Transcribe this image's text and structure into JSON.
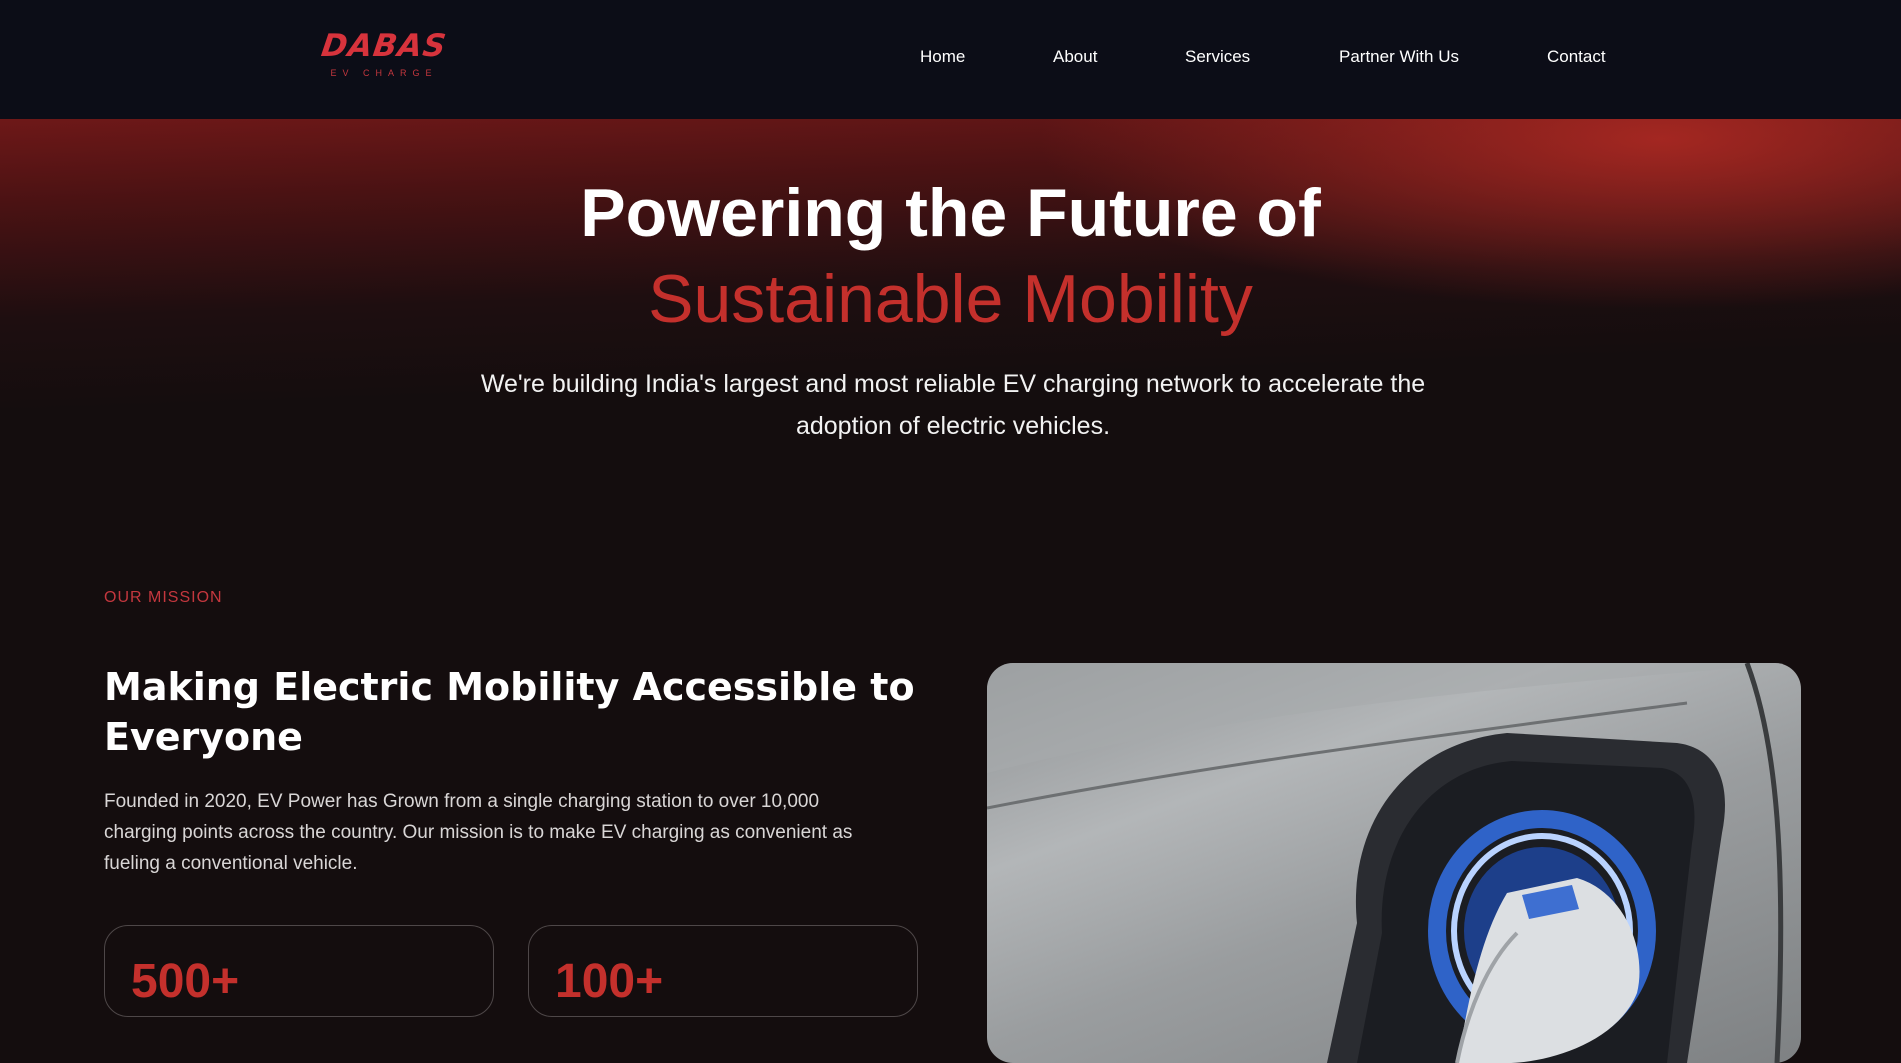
{
  "brand": {
    "name": "DABAS",
    "tagline": "EV CHARGE",
    "accent_color": "#c4302c"
  },
  "nav": {
    "links": [
      "Home",
      "About",
      "Services",
      "Partner With Us",
      "Contact"
    ]
  },
  "hero": {
    "title": "Powering the Future of",
    "title_accent": "Sustainable Mobility",
    "subtitle": "We're building India's largest and most reliable EV charging network to accelerate the adoption of electric vehicles."
  },
  "mission": {
    "eyebrow": "OUR MISSION",
    "title": "Making Electric Mobility Accessible to Everyone",
    "body": "Founded in 2020, EV Power has Grown from a single charging station to over 10,000 charging points across the country. Our mission is to make EV charging as convenient as fueling a conventional vehicle.",
    "stats": [
      "500+",
      "100+"
    ],
    "image_subject": "ev-charging-port-photo"
  }
}
